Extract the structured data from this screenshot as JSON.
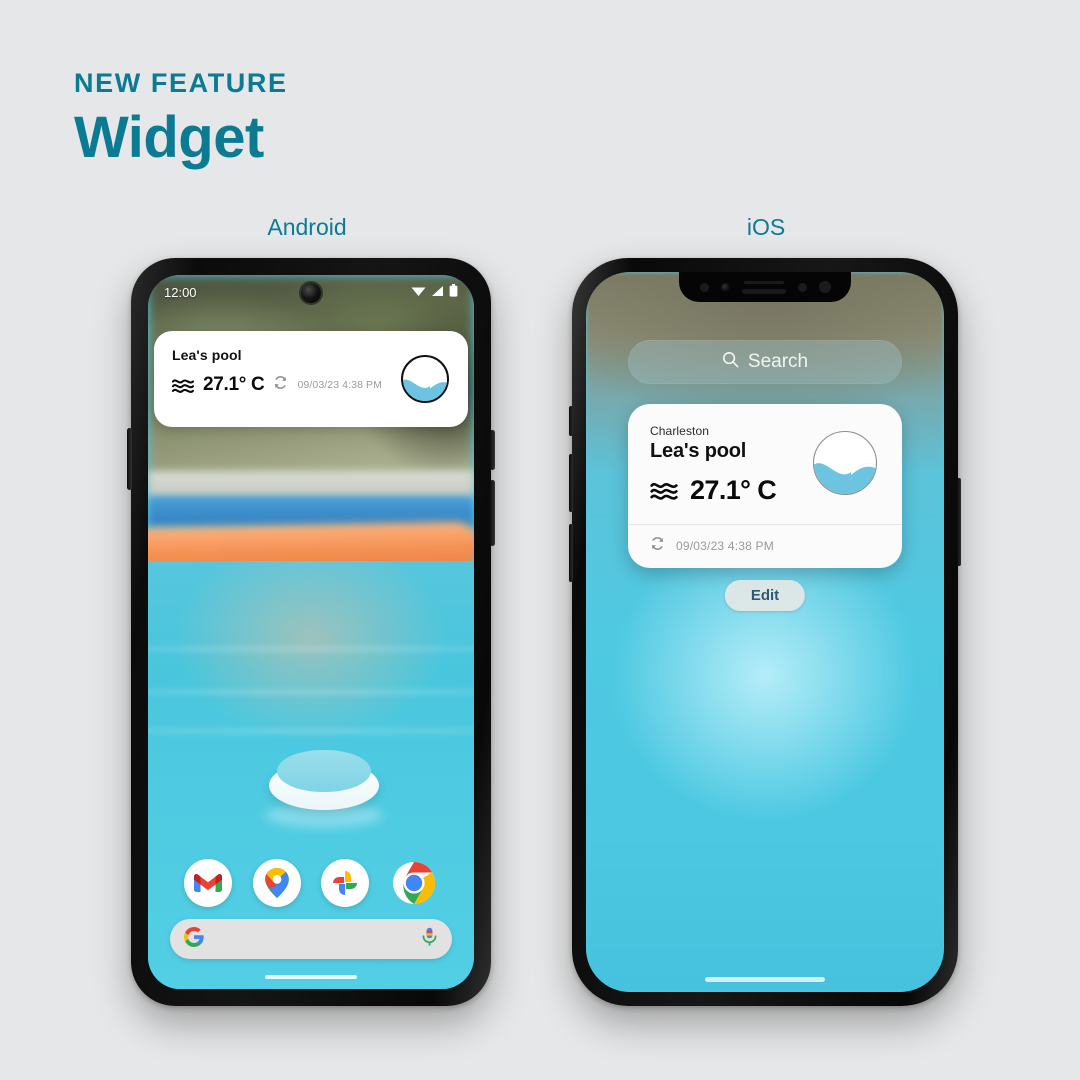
{
  "headline": {
    "kicker": "NEW FEATURE",
    "title": "Widget",
    "accent_color": "#0b7b94"
  },
  "platform_labels": {
    "android": "Android",
    "ios": "iOS"
  },
  "android": {
    "status_bar": {
      "time": "12:00",
      "icons": [
        "wifi-icon",
        "cellular-signal-icon",
        "battery-icon"
      ]
    },
    "widget": {
      "pool_name": "Lea's pool",
      "temperature": "27.1° C",
      "temperature_icon": "water-wave-icon",
      "refresh_icon": "refresh-icon",
      "timestamp": "09/03/23 4:38 PM",
      "logo": "pool-wave-logo-icon",
      "background_color": "#ffffff"
    },
    "dock": {
      "apps": [
        {
          "name": "gmail-app-icon",
          "label": "Gmail"
        },
        {
          "name": "google-maps-app-icon",
          "label": "Maps"
        },
        {
          "name": "google-photos-app-icon",
          "label": "Photos"
        },
        {
          "name": "chrome-app-icon",
          "label": "Chrome"
        }
      ]
    },
    "search_bar": {
      "left_icon": "google-g-icon",
      "right_icon": "microphone-icon",
      "placeholder": ""
    },
    "home_indicator": "home-gesture-bar"
  },
  "ios": {
    "search": {
      "label": "Search",
      "icon": "search-icon"
    },
    "widget": {
      "city": "Charleston",
      "pool_name": "Lea's pool",
      "temperature": "27.1° C",
      "temperature_icon": "water-wave-icon",
      "refresh_icon": "refresh-icon",
      "timestamp": "09/03/23 4:38 PM",
      "logo": "pool-wave-logo-icon",
      "background_color": "#fbfbfb"
    },
    "edit_button": "Edit",
    "home_indicator": "home-gesture-bar"
  },
  "colors": {
    "page_background": "#e6e7e8",
    "teal_accent": "#0b7b94",
    "logo_blue": "#6cc4e0",
    "water_cyan": "#4fc9e2"
  }
}
